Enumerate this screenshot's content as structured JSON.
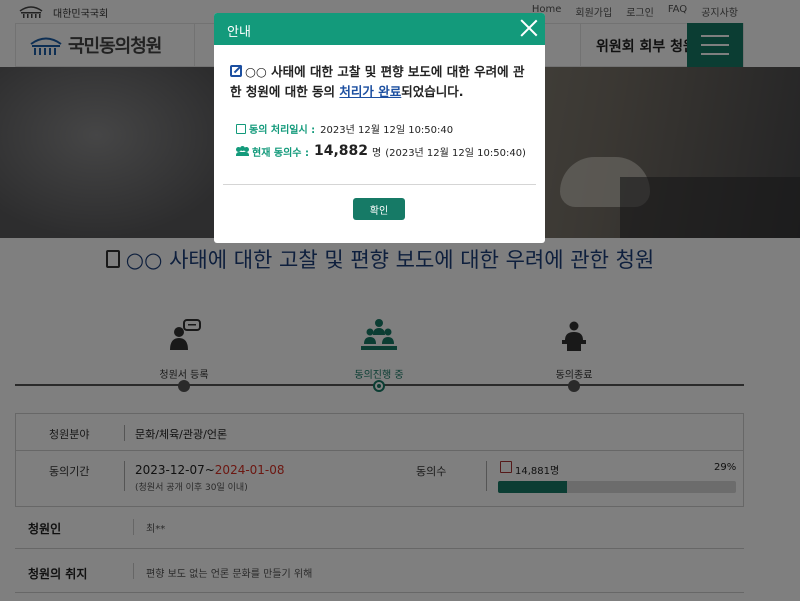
{
  "topbar": {
    "gov_label": "대한민국국회",
    "links": [
      "Home",
      "회원가입",
      "로그인",
      "FAQ",
      "공지사항"
    ]
  },
  "header": {
    "logo_text": "국민동의청원",
    "committee_label": "위원회 회부 청원"
  },
  "petition": {
    "title": "○○ 사태에 대한 고찰 및 편향 보도에 대한 우려에 관한 청원",
    "steps": [
      {
        "label": "청원서 등록",
        "active": false
      },
      {
        "label": "동의진행 중",
        "active": true
      },
      {
        "label": "동의종료",
        "active": false
      }
    ],
    "field_label": "청원분야",
    "field_value": "문화/체육/관광/언론",
    "period_label": "동의기간",
    "period_start": "2023-12-07~",
    "period_end": "2024-01-08",
    "period_note": "(청원서 공개 이후 30일 이내)",
    "count_label": "동의수",
    "count_value": "14,881명",
    "progress_percent": "29%",
    "progress_fraction": 0.29,
    "petitioner_label": "청원인",
    "petitioner_value": "최**",
    "purpose_label": "청원의 취지",
    "purpose_value": "편향 보도 없는 언론 문화를 만들기 위해"
  },
  "modal": {
    "title": "안내",
    "message_part1": "○○ 사태에 대한 고찰 및 편향 보도에 대한 우려에 관한 청원에 대한 동의 ",
    "message_link": "처리가 완료",
    "message_part2": "되었습니다.",
    "processed_label": "동의 처리일시 :",
    "processed_value": "2023년 12월 12일 10:50:40",
    "current_label": "현재 동의수 :",
    "current_count": "14,882",
    "current_unit": "명",
    "current_time": "(2023년 12월 12일 10:50:40)",
    "confirm_label": "확인"
  },
  "colors": {
    "accent": "#139a7b",
    "brand": "#167a66",
    "link": "#1c4fa0",
    "title_blue": "#1c3f7a",
    "deadline_red": "#d93025"
  }
}
